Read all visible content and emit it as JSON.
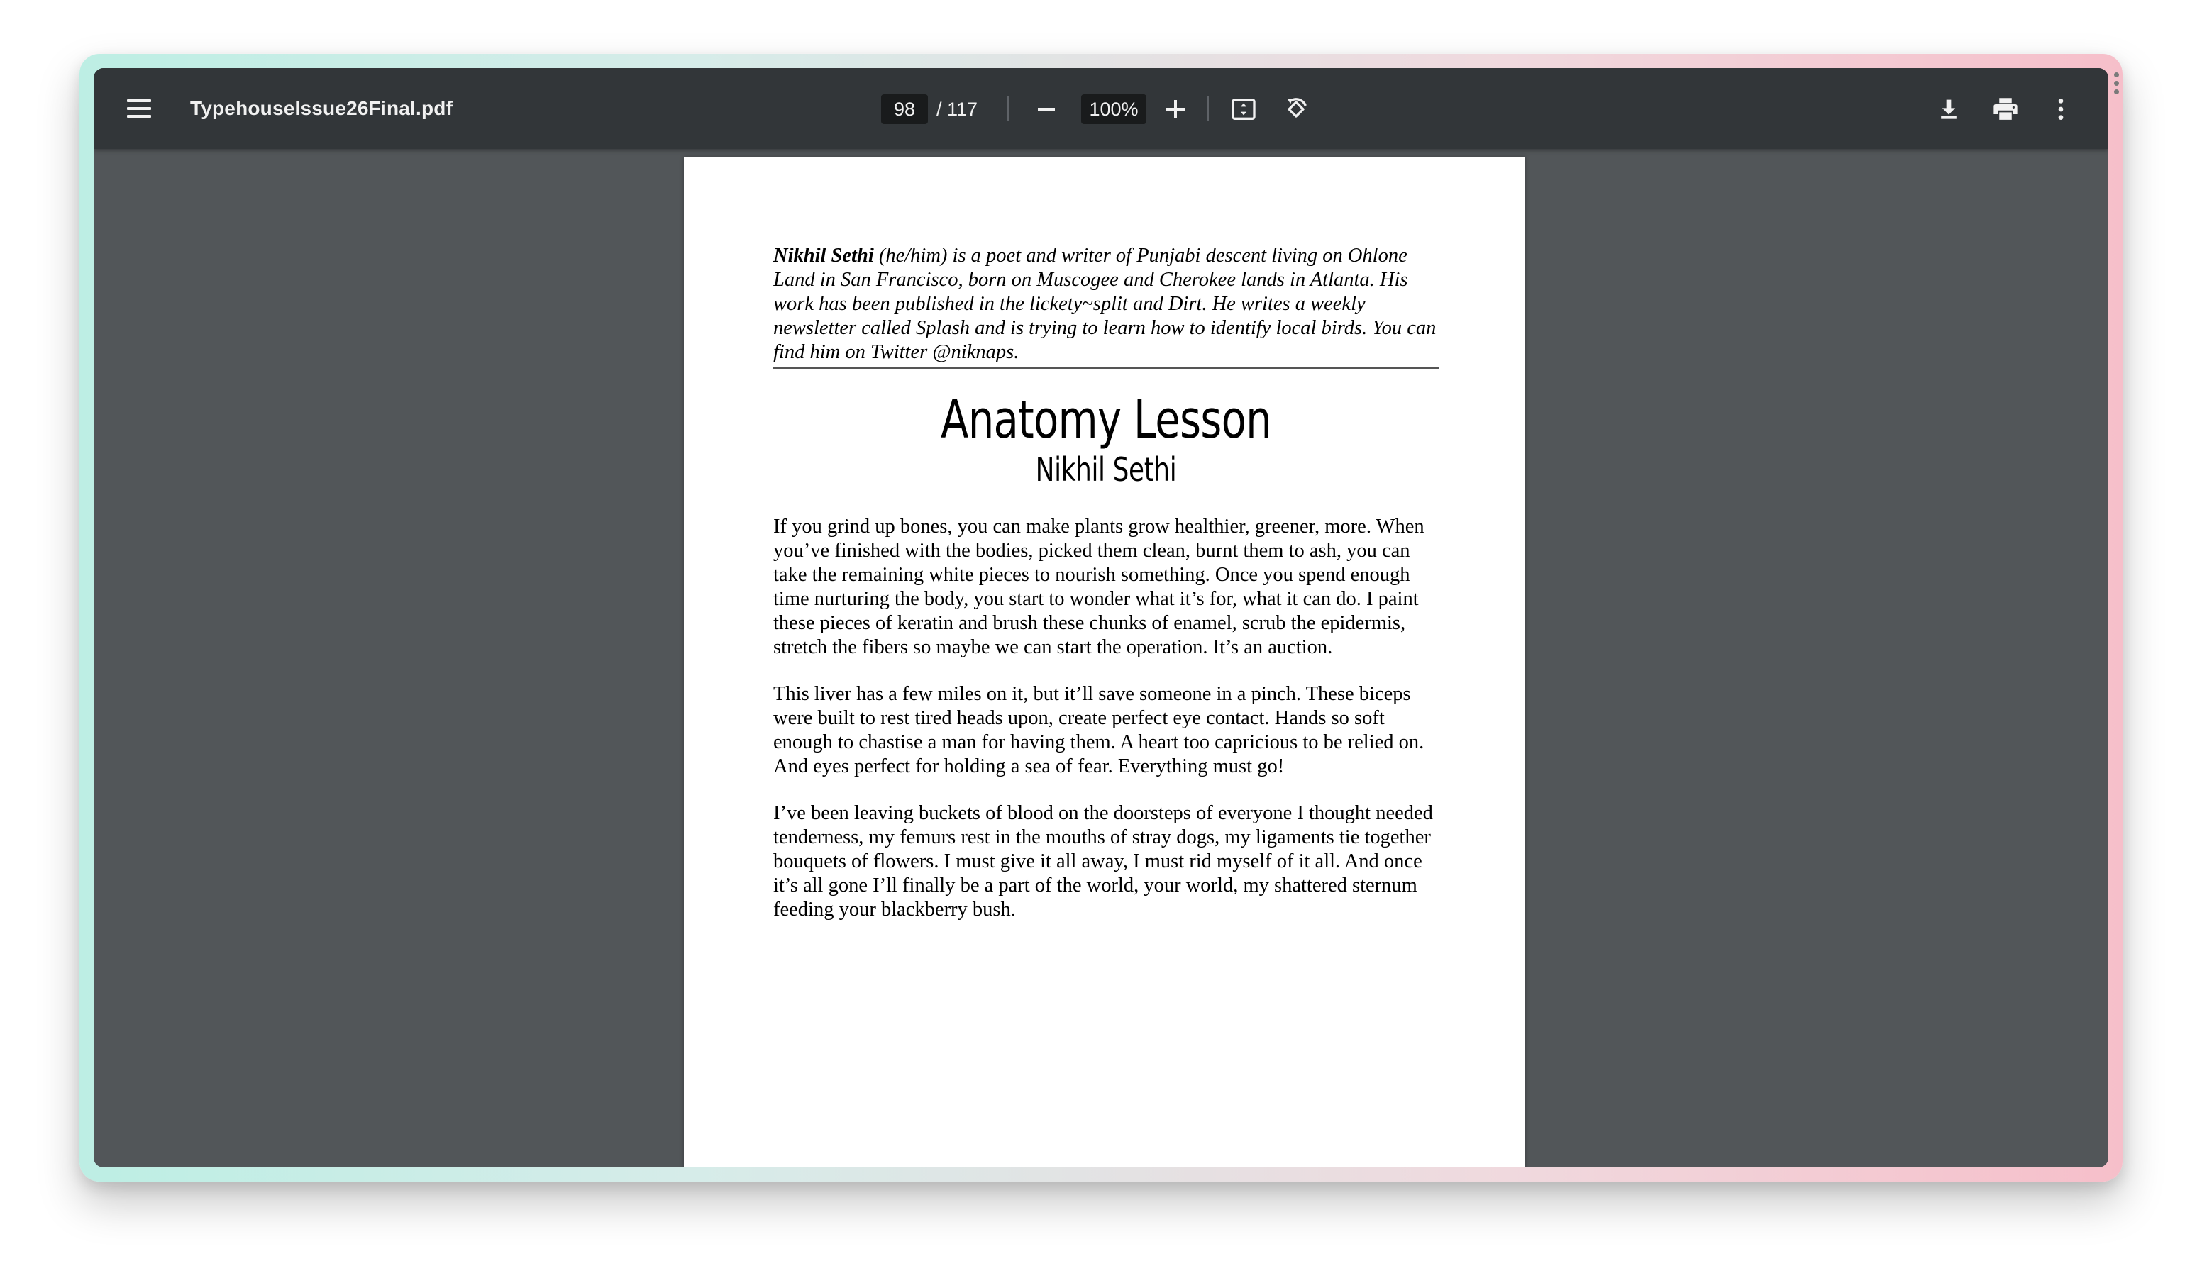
{
  "toolbar": {
    "file_name": "TypehouseIssue26Final.pdf",
    "current_page": "98",
    "page_total": "/ 117",
    "zoom": "100%",
    "icons": {
      "menu": "hamburger-menu-icon",
      "zoom_out": "minus-icon",
      "zoom_in": "plus-icon",
      "fit": "fit-to-page-icon",
      "rotate": "rotate-counterclockwise-icon",
      "download": "download-icon",
      "print": "print-icon",
      "more": "more-vertical-icon"
    }
  },
  "document": {
    "bio_name": "Nikhil Sethi",
    "bio_text": " (he/him) is a poet and writer of Punjabi descent living on Ohlone Land in San Francisco, born on Muscogee and Cherokee lands in Atlanta. His work has been published in the lickety~split and Dirt. He writes a weekly newsletter called Splash and is trying to learn how to identify local birds. You can find him on Twitter @niknaps.",
    "title": "Anatomy Lesson",
    "author": "Nikhil Sethi",
    "paragraphs": [
      "If you grind up bones, you can make plants grow healthier, greener, more. When you’ve finished with the bodies, picked them clean, burnt them to ash, you can take the remaining white pieces to nourish something. Once you spend enough time nurturing the body, you start to wonder what it’s for, what it can do. I paint these pieces of keratin and brush these chunks of enamel, scrub the epidermis, stretch the fibers so maybe we can start the operation. It’s an auction.",
      "This liver has a few miles on it, but it’ll save someone in a pinch. These biceps were built to rest tired heads upon, create perfect eye contact. Hands so soft enough to chastise a man for having them. A heart too capricious to be relied on. And eyes perfect for holding a sea of fear. Everything must go!",
      "I’ve been leaving buckets of blood on the doorsteps of everyone I thought needed tenderness, my femurs rest in the mouths of stray dogs, my ligaments tie together bouquets of flowers. I must give it all away, I must rid myself of it all. And once it’s all gone I’ll finally be a part of the world, your world, my shattered sternum feeding your blackberry bush."
    ]
  },
  "colors": {
    "toolbar_bg": "#323639",
    "viewer_bg": "#525659",
    "page_bg": "#ffffff",
    "input_bg": "#191b1c"
  }
}
